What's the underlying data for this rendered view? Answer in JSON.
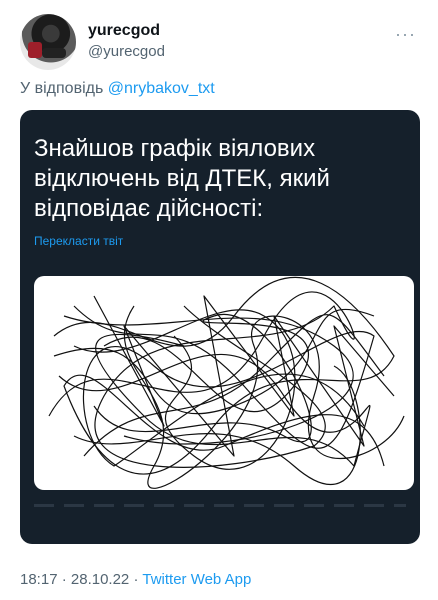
{
  "tweet": {
    "display_name": "yurecgod",
    "handle": "@yurecgod",
    "more_icon": "more-dots-icon",
    "reply_prefix": "У відповідь",
    "reply_to": "@nrybakov_txt",
    "time": "18:17",
    "date": "28.10.22",
    "separator": "·",
    "source": "Twitter Web App"
  },
  "embedded": {
    "text": "Знайшов графік віялових відключень від ДТЕК, який відповідає дійсності:",
    "translate_label": "Перекласти твіт",
    "image_icon": "scribble-image"
  },
  "colors": {
    "card_bg": "#15202b",
    "link": "#1d9bf0",
    "muted": "#536471"
  }
}
